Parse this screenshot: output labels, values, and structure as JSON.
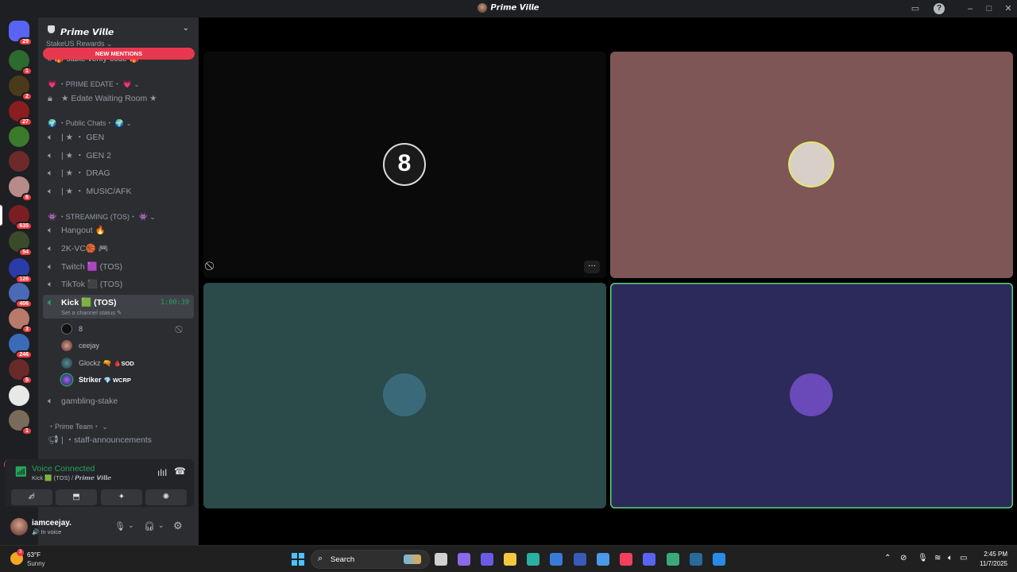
{
  "window": {
    "title": "𝙋𝙧𝙞𝙢𝙚 𝙑𝙞𝙡𝙡𝙚"
  },
  "rail": {
    "servers": [
      {
        "name": "discord-home",
        "badge": "29",
        "color": "#5865f2"
      },
      {
        "name": "server-1",
        "badge": "1",
        "color": "#2d6a2f"
      },
      {
        "name": "server-2",
        "badge": "2",
        "color": "#4a3a1a"
      },
      {
        "name": "server-3",
        "badge": "27",
        "color": "#8a1e1e"
      },
      {
        "name": "server-4",
        "badge": "",
        "color": "#3b7a2a"
      },
      {
        "name": "server-5",
        "badge": "",
        "color": "#6e2a2a"
      },
      {
        "name": "server-6",
        "badge": "6",
        "color": "#b88a8a"
      },
      {
        "name": "server-7",
        "badge": "635",
        "color": "#7a1e24"
      },
      {
        "name": "server-8",
        "badge": "54",
        "color": "#3b4a2a"
      },
      {
        "name": "server-9",
        "badge": "126",
        "color": "#2a3ca8"
      },
      {
        "name": "server-10",
        "badge": "406",
        "color": "#4a6ab8"
      },
      {
        "name": "server-11",
        "badge": "3",
        "color": "#b87a6a"
      },
      {
        "name": "server-12",
        "badge": "246",
        "color": "#3a6ab8"
      },
      {
        "name": "server-13",
        "badge": "5",
        "color": "#6a2a2a"
      },
      {
        "name": "server-14",
        "badge": "",
        "color": "#e8e8e8"
      },
      {
        "name": "server-15",
        "badge": "1",
        "color": "#7a6a5a"
      }
    ],
    "new_label": "NEW"
  },
  "sidebar": {
    "server_name": "𝙋𝙧𝙞𝙢𝙚 𝙑𝙞𝙡𝙡𝙚",
    "partial_category": "StakeUS Rewards ⌄",
    "new_mentions": "NEW MENTIONS",
    "cut_channel": "# 🎁 stake-verify-code 🎁",
    "categories": {
      "prime_edate": "💗 ・PRIME EDATE・ 💗 ⌄",
      "public_chats": "🌍 ・Public Chats・ 🌍 ⌄",
      "streaming": "👾 ・STREAMING (TOS)・ 👾 ⌄",
      "prime_team": "・Prime Team・ ⌄"
    },
    "channels": {
      "edate_waiting": "★ Edate Waiting Room ★",
      "gen": "| ★ ・ GEN",
      "gen2": "| ★ ・ GEN 2",
      "drag": "| ★ ・ DRAG",
      "music": "| ★ ・ MUSIC/AFK",
      "hangout": "Hangout 🔥",
      "twok": "2K-VC🏀 🎮",
      "twitch": "Twitch 🟪 (TOS)",
      "tiktok": "TikTok ⬛ (TOS)",
      "kick": "Kick 🟩 (TOS)",
      "kick_timer": "1:00:39",
      "kick_status": "Set a channel status ✎",
      "gambling": "gambling-stake",
      "staff": "| ・staff-announcements"
    },
    "members": [
      {
        "name": "8",
        "tag": ""
      },
      {
        "name": "ceejay",
        "tag": ""
      },
      {
        "name": "Glockz 🔫",
        "tag": "🩸SOD"
      },
      {
        "name": "Striker",
        "tag": "💎 WCRP"
      }
    ]
  },
  "voice_panel": {
    "title": "Voice Connected",
    "sub_prefix": "Kick 🟩 (TOS) / ",
    "sub_server": "𝙋𝙧𝙞𝙢𝙚 𝙑𝙞𝙡𝙡𝙚"
  },
  "user_panel": {
    "name": "iamceejay.",
    "status": "🔊 In voice"
  },
  "stage": {
    "tiles": [
      {
        "name": "8",
        "bg": "#0a0a0a",
        "avatar": "#1a1a1a"
      },
      {
        "name": "ceejay",
        "bg": "#7e5656",
        "avatar": "#d8d0c8"
      },
      {
        "name": "Glockz",
        "bg": "#2b4a4a",
        "avatar": "#3a6a7a"
      },
      {
        "name": "Striker",
        "bg": "#2b2a5a",
        "avatar": "#6a4ab8"
      }
    ],
    "tile_avatar_label": "8"
  },
  "taskbar": {
    "temp": "63°F",
    "weather": "Sunny",
    "weather_badge": "3",
    "search": "Search",
    "time": "2:45 PM",
    "date": "11/7/2025",
    "apps": [
      "explorer-tasks",
      "copilot-icon",
      "teams-icon",
      "file-explorer-icon",
      "edge-icon",
      "store-icon",
      "l-app-icon",
      "code-icon",
      "music-icon",
      "discord-icon",
      "android-icon",
      "steam-icon",
      "launcher-icon"
    ],
    "app_colors": [
      "#d0d0d0",
      "#8a6ae8",
      "#6a5ae8",
      "#f5c842",
      "#2ab0a0",
      "#3a7ad8",
      "#3a5ab8",
      "#4a9ae8",
      "#f23f5f",
      "#5865f2",
      "#3aa87a",
      "#2a6a9a",
      "#2a8ae8"
    ]
  }
}
